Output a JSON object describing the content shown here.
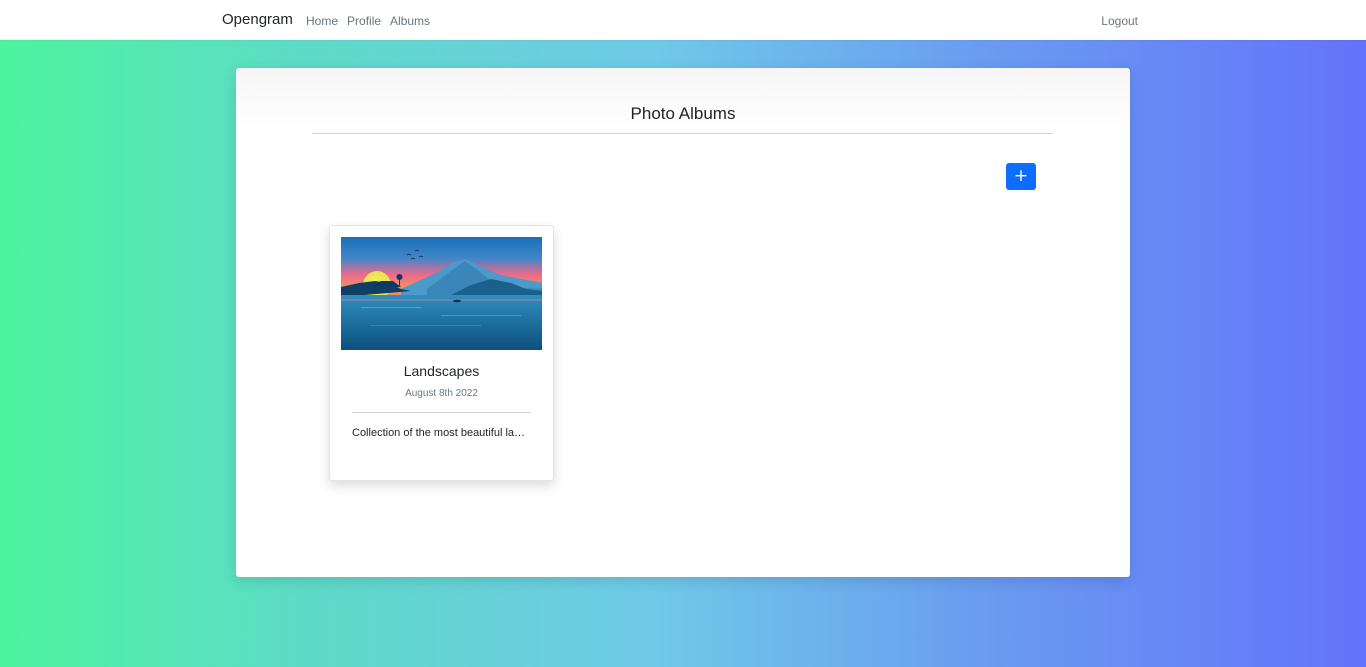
{
  "navbar": {
    "brand": "Opengram",
    "links": [
      "Home",
      "Profile",
      "Albums"
    ],
    "logout": "Logout"
  },
  "main": {
    "title": "Photo Albums",
    "add_button_icon": "plus-icon",
    "add_button_label": "+"
  },
  "albums": [
    {
      "name": "Landscapes",
      "date": "August 8th 2022",
      "description": "Collection of the most beautiful landscapes",
      "thumbnail": "sunset-mountain-lake-illustration"
    }
  ],
  "colors": {
    "accent": "#0d6efd",
    "gradient_start": "#4cf49f",
    "gradient_end": "#6373fb"
  }
}
